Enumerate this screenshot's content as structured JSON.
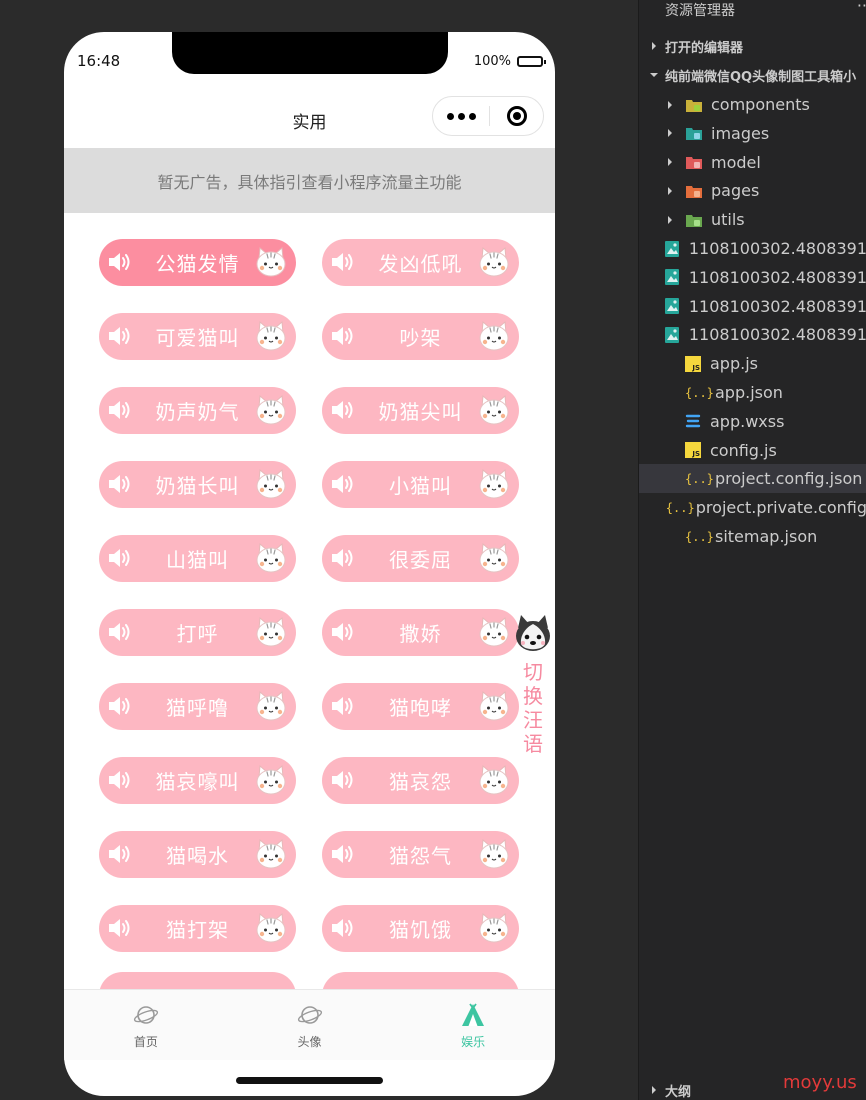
{
  "phone": {
    "status": {
      "time": "16:48",
      "battery": "100%"
    },
    "nav_title": "实用",
    "ad_text": "暂无广告，具体指引查看小程序流量主功能",
    "sound_buttons": [
      {
        "label": "公猫发情",
        "active": true
      },
      {
        "label": "发凶低吼"
      },
      {
        "label": "可爱猫叫"
      },
      {
        "label": "吵架"
      },
      {
        "label": "奶声奶气"
      },
      {
        "label": "奶猫尖叫"
      },
      {
        "label": "奶猫长叫"
      },
      {
        "label": "小猫叫"
      },
      {
        "label": "山猫叫"
      },
      {
        "label": "很委屈"
      },
      {
        "label": "打呼"
      },
      {
        "label": "撒娇"
      },
      {
        "label": "猫呼噜"
      },
      {
        "label": "猫咆哮"
      },
      {
        "label": "猫哀嚎叫"
      },
      {
        "label": "猫哀怨"
      },
      {
        "label": "猫喝水"
      },
      {
        "label": "猫怨气"
      },
      {
        "label": "猫打架"
      },
      {
        "label": "猫饥饿"
      }
    ],
    "switch_text": "切换汪语",
    "tabs": [
      {
        "label": "首页",
        "icon": "planet-icon"
      },
      {
        "label": "头像",
        "icon": "planet-icon"
      },
      {
        "label": "娱乐",
        "icon": "tent-icon",
        "selected": true
      }
    ],
    "colors": {
      "button": "#fdb7c2",
      "button_active": "#fc8ea0",
      "tab_selected": "#3dc5a1"
    }
  },
  "explorer": {
    "title": "资源管理器",
    "more": "··",
    "open_editors": "打开的编辑器",
    "project": "纯前端微信QQ头像制图工具箱小",
    "items": [
      {
        "name": "components",
        "kind": "folder",
        "icon": "folder-yellow-icon"
      },
      {
        "name": "images",
        "kind": "folder",
        "icon": "folder-teal-icon"
      },
      {
        "name": "model",
        "kind": "folder",
        "icon": "folder-red-icon"
      },
      {
        "name": "pages",
        "kind": "folder",
        "icon": "folder-orange-icon"
      },
      {
        "name": "utils",
        "kind": "folder",
        "icon": "folder-green-icon"
      },
      {
        "name": "1108100302.4808391",
        "kind": "image"
      },
      {
        "name": "1108100302.4808391",
        "kind": "image"
      },
      {
        "name": "1108100302.4808391",
        "kind": "image"
      },
      {
        "name": "1108100302.4808391",
        "kind": "image"
      },
      {
        "name": "app.js",
        "kind": "js"
      },
      {
        "name": "app.json",
        "kind": "json"
      },
      {
        "name": "app.wxss",
        "kind": "css"
      },
      {
        "name": "config.js",
        "kind": "js"
      },
      {
        "name": "project.config.json",
        "kind": "json",
        "selected": true
      },
      {
        "name": "project.private.config",
        "kind": "json"
      },
      {
        "name": "sitemap.json",
        "kind": "json"
      }
    ],
    "outline": "大纲"
  },
  "watermark": "moyy.us"
}
